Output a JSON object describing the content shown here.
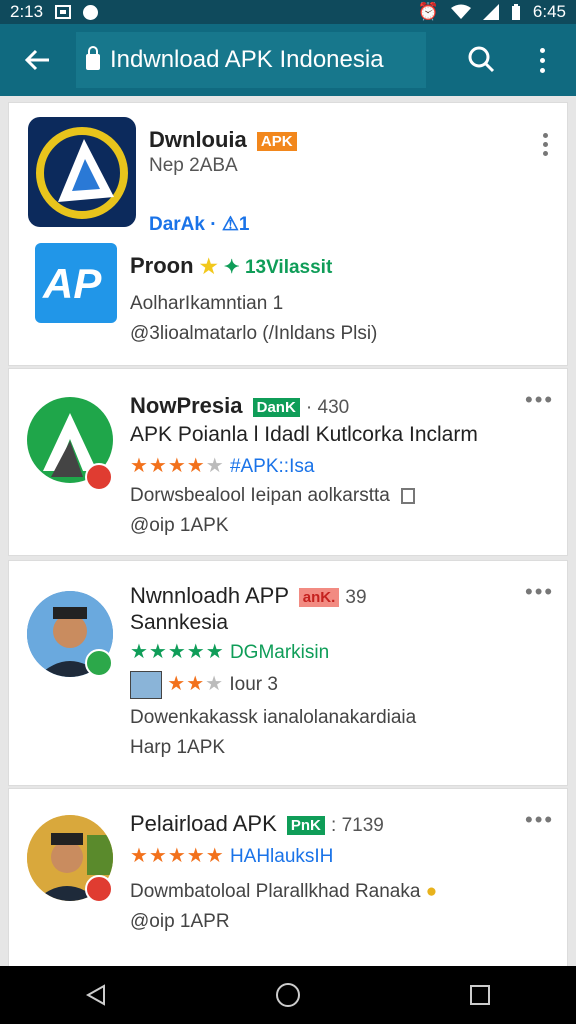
{
  "status": {
    "time_left": "2:13",
    "time_right": "6:45"
  },
  "appbar": {
    "title": "Indwnload APK Indonesia"
  },
  "cards": [
    {
      "title": "Dwnlouia",
      "badge": "APK",
      "line2": "Nep 2ABA",
      "line3": "DarAk · ⚠1",
      "colors": {
        "badge": "#f2871c"
      }
    },
    {
      "title": "Proon",
      "extra": "✦ 13Vilassit",
      "line2": "AolharIkamntian 1",
      "line3": "@3lioalmatarlo (/Inldans Plsi)"
    },
    {
      "title": "NowPresia",
      "badge": "DanK",
      "count": "· 430",
      "line2": "APK Poianla l Idadl Kutlcorka Inclarm",
      "stars_text": "#APK::Isa",
      "stars_on": 4,
      "line4": "Dorwsbealool Ieipan aolkarstta",
      "line5": "@oip 1APK",
      "colors": {
        "badge": "#0f9d58"
      }
    },
    {
      "title": "Nwnnloadh APP",
      "badge": "anK.",
      "count": "39",
      "line2": "Sannkesia",
      "stars_text": "DGMarkisin",
      "mini_text": "Iour 3",
      "line4": "Dowenkakassk ianalolanakardiaia",
      "line5": "Harp 1APK",
      "colors": {
        "badge": "#e8453c"
      }
    },
    {
      "title": "Pelairload APK",
      "badge": "PnK",
      "count": ": 7139",
      "stars_text": "HAHlauksIH",
      "line4": "Dowmbatoloal Plarallkhad Ranaka",
      "line5": "@oip 1APR",
      "colors": {
        "badge": "#0f9d58"
      }
    }
  ],
  "colors": {
    "statusbar": "#0f4a5c",
    "appbar": "#106a80",
    "accent": "#1a73e8",
    "star": "#f2711c",
    "green": "#0f9d58"
  }
}
